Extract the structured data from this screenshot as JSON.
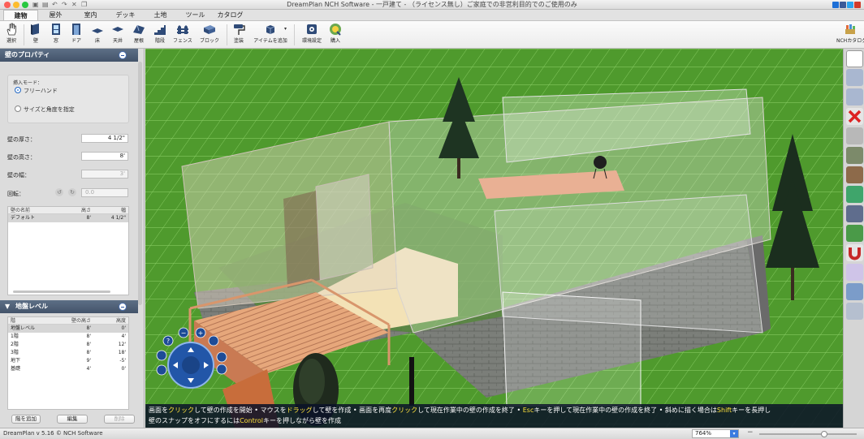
{
  "window": {
    "title": "DreamPlan NCH Software - 一戸建て - （ライセンス無し）ご家庭での非営利目的でのご使用のみ"
  },
  "tabs": [
    "建物",
    "屋外",
    "室内",
    "デッキ",
    "土地",
    "ツール",
    "カタログ"
  ],
  "active_tab": "建物",
  "toolbar": {
    "tools": [
      {
        "label": "選択",
        "icon": "hand-icon"
      },
      {
        "label": "壁",
        "icon": "wall-icon"
      },
      {
        "label": "窓",
        "icon": "window-icon"
      },
      {
        "label": "ドア",
        "icon": "door-icon"
      },
      {
        "label": "床",
        "icon": "floor-icon"
      },
      {
        "label": "天井",
        "icon": "ceiling-icon"
      },
      {
        "label": "屋根",
        "icon": "roof-icon"
      },
      {
        "label": "階段",
        "icon": "stairs-icon"
      },
      {
        "label": "フェンス",
        "icon": "fence-icon"
      },
      {
        "label": "ブロック",
        "icon": "block-icon"
      },
      {
        "label": "塗装",
        "icon": "paint-roller-icon"
      },
      {
        "label": "アイテムを追加",
        "icon": "add-item-icon"
      },
      {
        "label": "環境設定",
        "icon": "settings-icon"
      },
      {
        "label": "購入",
        "icon": "buy-icon"
      }
    ],
    "catalog_label": "NCHカタログ"
  },
  "wall_properties": {
    "title": "壁のプロパティ",
    "insert_mode_label": "挿入モード：",
    "mode_freehand": "フリーハンド",
    "mode_size_angle": "サイズと角度を指定",
    "selected_mode": "フリーハンド",
    "thickness_label": "壁の厚さ：",
    "thickness_value": "4 1/2\"",
    "height_label": "壁の高さ：",
    "height_value": "8'",
    "width_label": "壁の幅：",
    "width_value": "3'",
    "rotation_label": "回転：",
    "rotation_value": "0.0",
    "table": {
      "headers": [
        "壁の名前",
        "高さ",
        "幅"
      ],
      "rows": [
        [
          "デフォルト",
          "8'",
          "4 1/2\""
        ]
      ]
    }
  },
  "floor_levels": {
    "title": "地盤レベル",
    "headers": [
      "階",
      "壁の高さ",
      "高度"
    ],
    "rows": [
      [
        "地盤レベル",
        "8'",
        "0'"
      ],
      [
        "1階",
        "8'",
        "4'"
      ],
      [
        "2階",
        "8'",
        "12'"
      ],
      [
        "3階",
        "8'",
        "18'"
      ],
      [
        "地下",
        "9'",
        "-5'"
      ],
      [
        "基礎",
        "4'",
        "0'"
      ]
    ],
    "selected_row": 0,
    "add_button": "階を追加",
    "edit_button": "編集",
    "delete_button": "削除"
  },
  "hint": {
    "line1": [
      {
        "t": "画面を",
        "h": false
      },
      {
        "t": "クリック",
        "h": true
      },
      {
        "t": "して壁の作成を開始 • マウスを",
        "h": false
      },
      {
        "t": "ドラッグ",
        "h": true
      },
      {
        "t": "して壁を作成 • 画面を再度",
        "h": false
      },
      {
        "t": "クリック",
        "h": true
      },
      {
        "t": "して現在作業中の壁の作成を終了 • ",
        "h": false
      },
      {
        "t": "Esc",
        "h": true
      },
      {
        "t": "キーを押して現在作業中の壁の作成を終了 • 斜めに描く場合は",
        "h": false
      },
      {
        "t": "Shift",
        "h": true
      },
      {
        "t": "キーを長押し",
        "h": false
      }
    ],
    "line2": [
      {
        "t": "壁のスナップをオフにするには",
        "h": false
      },
      {
        "t": "Control",
        "h": true
      },
      {
        "t": "キーを押しながら壁を作成",
        "h": false
      }
    ]
  },
  "status": {
    "app_version": "DreamPlan v 5.16 © NCH Software",
    "zoom": "764%",
    "zoom_slider_fraction": 0.68
  },
  "colors": {
    "accent": "#4a6fae",
    "grass": "#4f9a2d",
    "panel_header": "#4d5d75",
    "highlight_text": "#ffe23c"
  }
}
